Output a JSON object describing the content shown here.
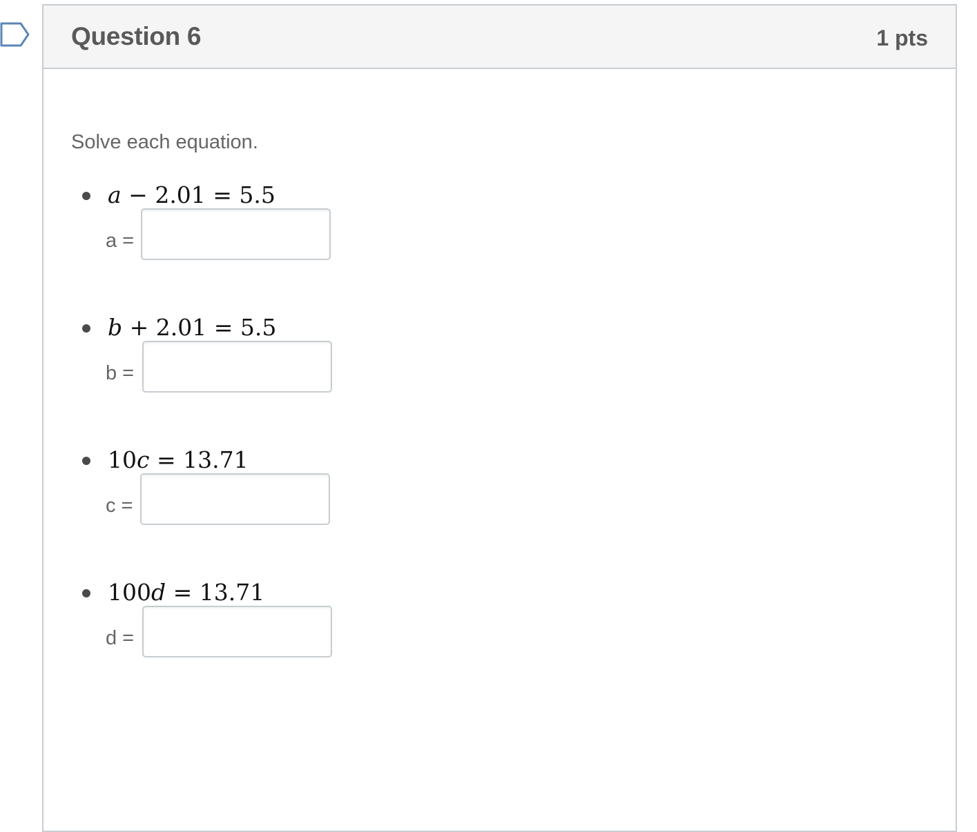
{
  "question": {
    "title": "Question 6",
    "points": "1 pts",
    "prompt": "Solve each equation."
  },
  "items": [
    {
      "eq_lhs_var": "a",
      "eq_op": " − 2.01 = 5.5",
      "label": "a =",
      "value": ""
    },
    {
      "eq_lhs_var": "b",
      "eq_op": " + 2.01 = 5.5",
      "label": "b =",
      "value": ""
    },
    {
      "eq_prefix": "10",
      "eq_lhs_var": "c",
      "eq_op": " = 13.71",
      "label": "c =",
      "value": ""
    },
    {
      "eq_prefix": "100",
      "eq_lhs_var": "d",
      "eq_op": " = 13.71",
      "label": "d =",
      "value": ""
    }
  ],
  "colors": {
    "header_bg": "#f5f5f5",
    "border": "#c7cdd1",
    "text_muted": "#666666"
  },
  "icons": {
    "flag": "question-flag-icon"
  }
}
